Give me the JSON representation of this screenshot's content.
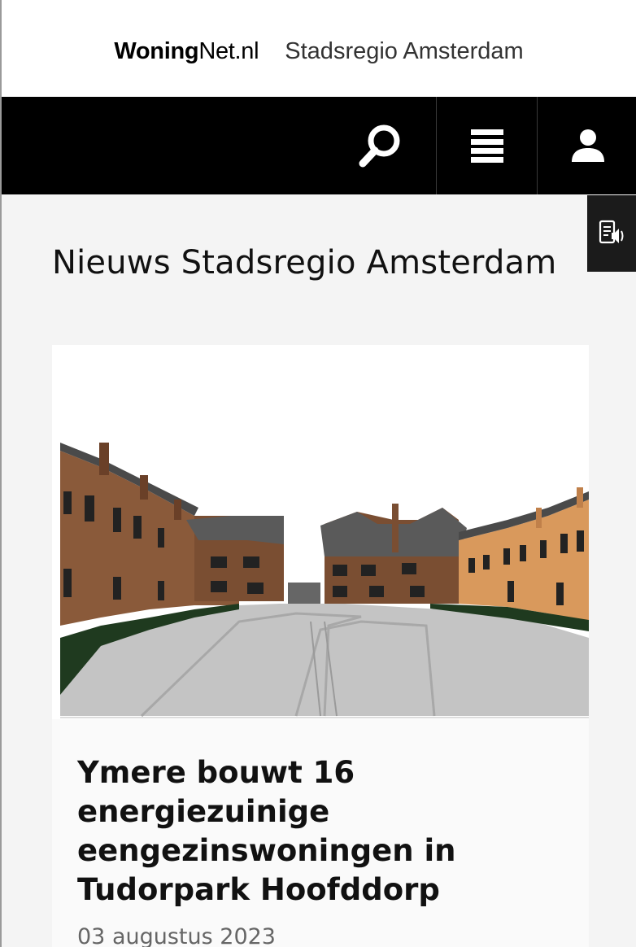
{
  "header": {
    "logo_bold": "Woning",
    "logo_rest": "Net.nl",
    "region": "Stadsregio Amsterdam"
  },
  "nav": {
    "icons": [
      "search-icon",
      "menu-icon",
      "user-icon"
    ]
  },
  "readspeaker": {
    "icon": "read-aloud-icon"
  },
  "page": {
    "title": "Nieuws Stadsregio Amsterdam"
  },
  "news": [
    {
      "title": "Ymere bouwt 16 energiezuinige eengezinswoningen in Tudorpark Hoofddorp",
      "date": "03 augustus 2023"
    }
  ],
  "colors": {
    "nav_background": "#000000",
    "page_background": "#f4f4f4",
    "readspeaker_background": "#1b1b1b"
  }
}
